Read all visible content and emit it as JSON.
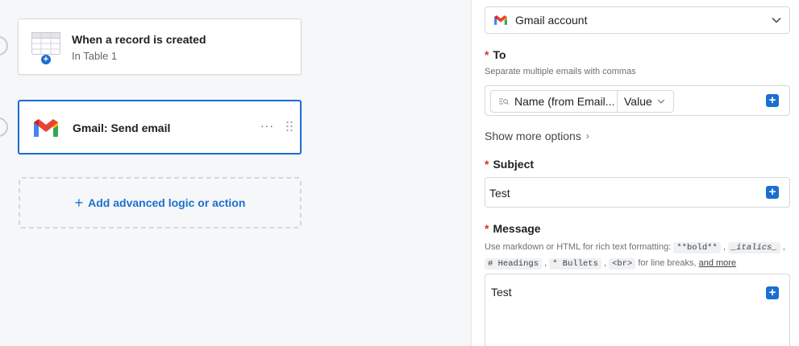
{
  "workflow": {
    "trigger": {
      "title": "When a record is created",
      "subtitle": "In Table 1"
    },
    "action": {
      "title": "Gmail: Send email",
      "more": "···"
    },
    "add_action_label": "Add advanced logic or action"
  },
  "panel": {
    "account": {
      "label": "Gmail account"
    },
    "to": {
      "required": "*",
      "label": "To",
      "help": "Separate multiple emails with commas",
      "token_name": "Name (from Email...",
      "token_mode": "Value"
    },
    "show_more": "Show more options",
    "subject": {
      "required": "*",
      "label": "Subject",
      "value": "Test"
    },
    "message": {
      "required": "*",
      "label": "Message",
      "help_prefix": "Use markdown or HTML for rich text formatting:",
      "bold": "**bold**",
      "italics": "_italics_",
      "headings": "# Headings",
      "bullets": "* Bullets",
      "br": "<br>",
      "help_br": "for line breaks,",
      "and_more": "and more",
      "value": "Test"
    }
  },
  "colors": {
    "accent": "#1b6fd1",
    "required": "#d2322d"
  }
}
